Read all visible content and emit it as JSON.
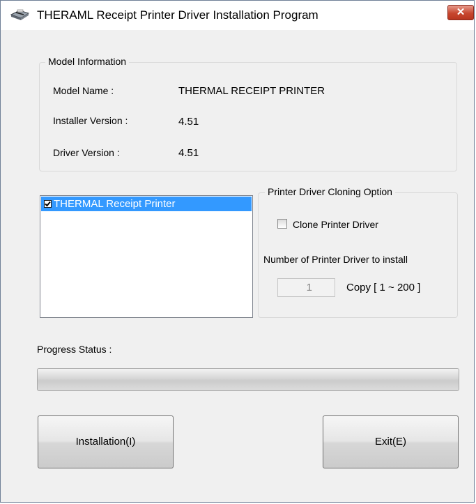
{
  "window": {
    "title": "THERAML Receipt Printer Driver Installation Program",
    "icon": "printer-icon",
    "close_glyph": "✕"
  },
  "model_info": {
    "legend": "Model Information",
    "model_name_label": "Model Name    :",
    "model_name_value": "THERMAL RECEIPT PRINTER",
    "installer_version_label": "Installer Version :",
    "installer_version_value": "4.51",
    "driver_version_label": "Driver Version    :",
    "driver_version_value": "4.51"
  },
  "printer_list": {
    "items": [
      {
        "label": "THERMAL Receipt Printer",
        "checked": true,
        "selected": true
      }
    ]
  },
  "cloning": {
    "legend": "Printer Driver Cloning Option",
    "clone_label": "Clone Printer Driver",
    "clone_checked": false,
    "number_label": "Number of Printer Driver to install",
    "copies_value": "1",
    "copies_range": "Copy [ 1 ~ 200 ]"
  },
  "progress": {
    "label": "Progress Status :",
    "value": 0
  },
  "buttons": {
    "install": "Installation(I)",
    "exit": "Exit(E)"
  },
  "colors": {
    "selection": "#3399ff",
    "close_button": "#c7462f",
    "window_bg": "#f0f0f0"
  }
}
